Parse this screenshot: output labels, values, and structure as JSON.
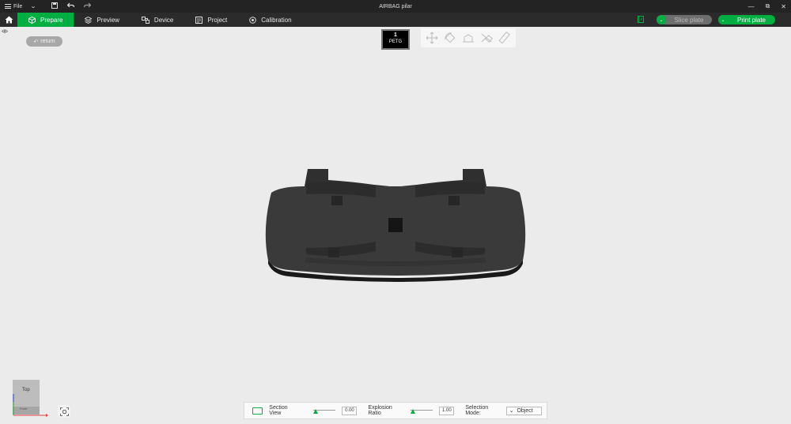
{
  "app": {
    "title": "AIRBAG pilar"
  },
  "titlebar": {
    "file_label": "File",
    "icons": [
      "menu-icon",
      "chevron-down-icon",
      "save-icon",
      "undo-icon",
      "redo-icon"
    ],
    "window_controls": {
      "minimize": "—",
      "restore": "⧉",
      "close": "✕"
    }
  },
  "tabs": [
    {
      "label": "Prepare",
      "icon": "cube-icon",
      "active": true
    },
    {
      "label": "Preview",
      "icon": "layers-icon",
      "active": false
    },
    {
      "label": "Device",
      "icon": "device-icon",
      "active": false
    },
    {
      "label": "Project",
      "icon": "project-icon",
      "active": false
    },
    {
      "label": "Calibration",
      "icon": "calibration-icon",
      "active": false
    }
  ],
  "actions": {
    "slice_label": "Slice plate",
    "print_label": "Print plate",
    "slice_enabled": false
  },
  "viewport": {
    "return_label": "return",
    "filament": {
      "number": "1",
      "type": "PETG"
    },
    "tools": [
      "move-icon",
      "rotate-icon",
      "place-on-face-icon",
      "cut-icon",
      "measure-icon"
    ],
    "viewcube_face": "Top",
    "viewcube_front": "Front"
  },
  "bottom": {
    "section_view_label": "Section View",
    "section_value": "0.00",
    "explosion_label": "Explosion Ratio",
    "explosion_value": "1.00",
    "selection_mode_label": "Selection Mode:",
    "selection_mode_value": "Object"
  },
  "colors": {
    "accent": "#00ae42",
    "titlebar_bg": "#232323",
    "toolbar_bg": "#2b2b2b",
    "viewport_bg": "#ebebeb",
    "part_color": "#3a3a3a"
  }
}
